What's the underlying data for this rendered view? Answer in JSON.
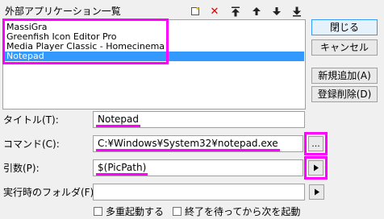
{
  "group_title": "外部アプリケーション一覧",
  "toolbar": {
    "icons": [
      "new-icon",
      "delete-icon",
      "move-top-icon",
      "move-up-icon",
      "move-down-icon",
      "move-bottom-icon"
    ]
  },
  "apps": [
    "MassiGra",
    "Greenfish Icon Editor Pro",
    "Media Player Classic - Homecinema",
    "Notepad"
  ],
  "selected_app": "Notepad",
  "buttons": {
    "close": "閉じる",
    "cancel": "キャンセル",
    "add_new": "新規追加(A)",
    "delete_entry": "登録削除(D)"
  },
  "fields": {
    "title_label": "タイトル(T):",
    "title_value": "Notepad",
    "command_label": "コマンド(C):",
    "command_value": "C:¥Windows¥System32¥notepad.exe",
    "browse_label": "...",
    "args_label": "引数(P):",
    "args_value": "$(PicPath)",
    "folder_label": "実行時のフォルダ(F):",
    "folder_value": ""
  },
  "checkboxes": {
    "multi_launch": "多重起動する",
    "wait_next": "終了を待ってから次を起動"
  },
  "colors": {
    "highlight": "#ff00ff",
    "selection": "#3399ff"
  }
}
